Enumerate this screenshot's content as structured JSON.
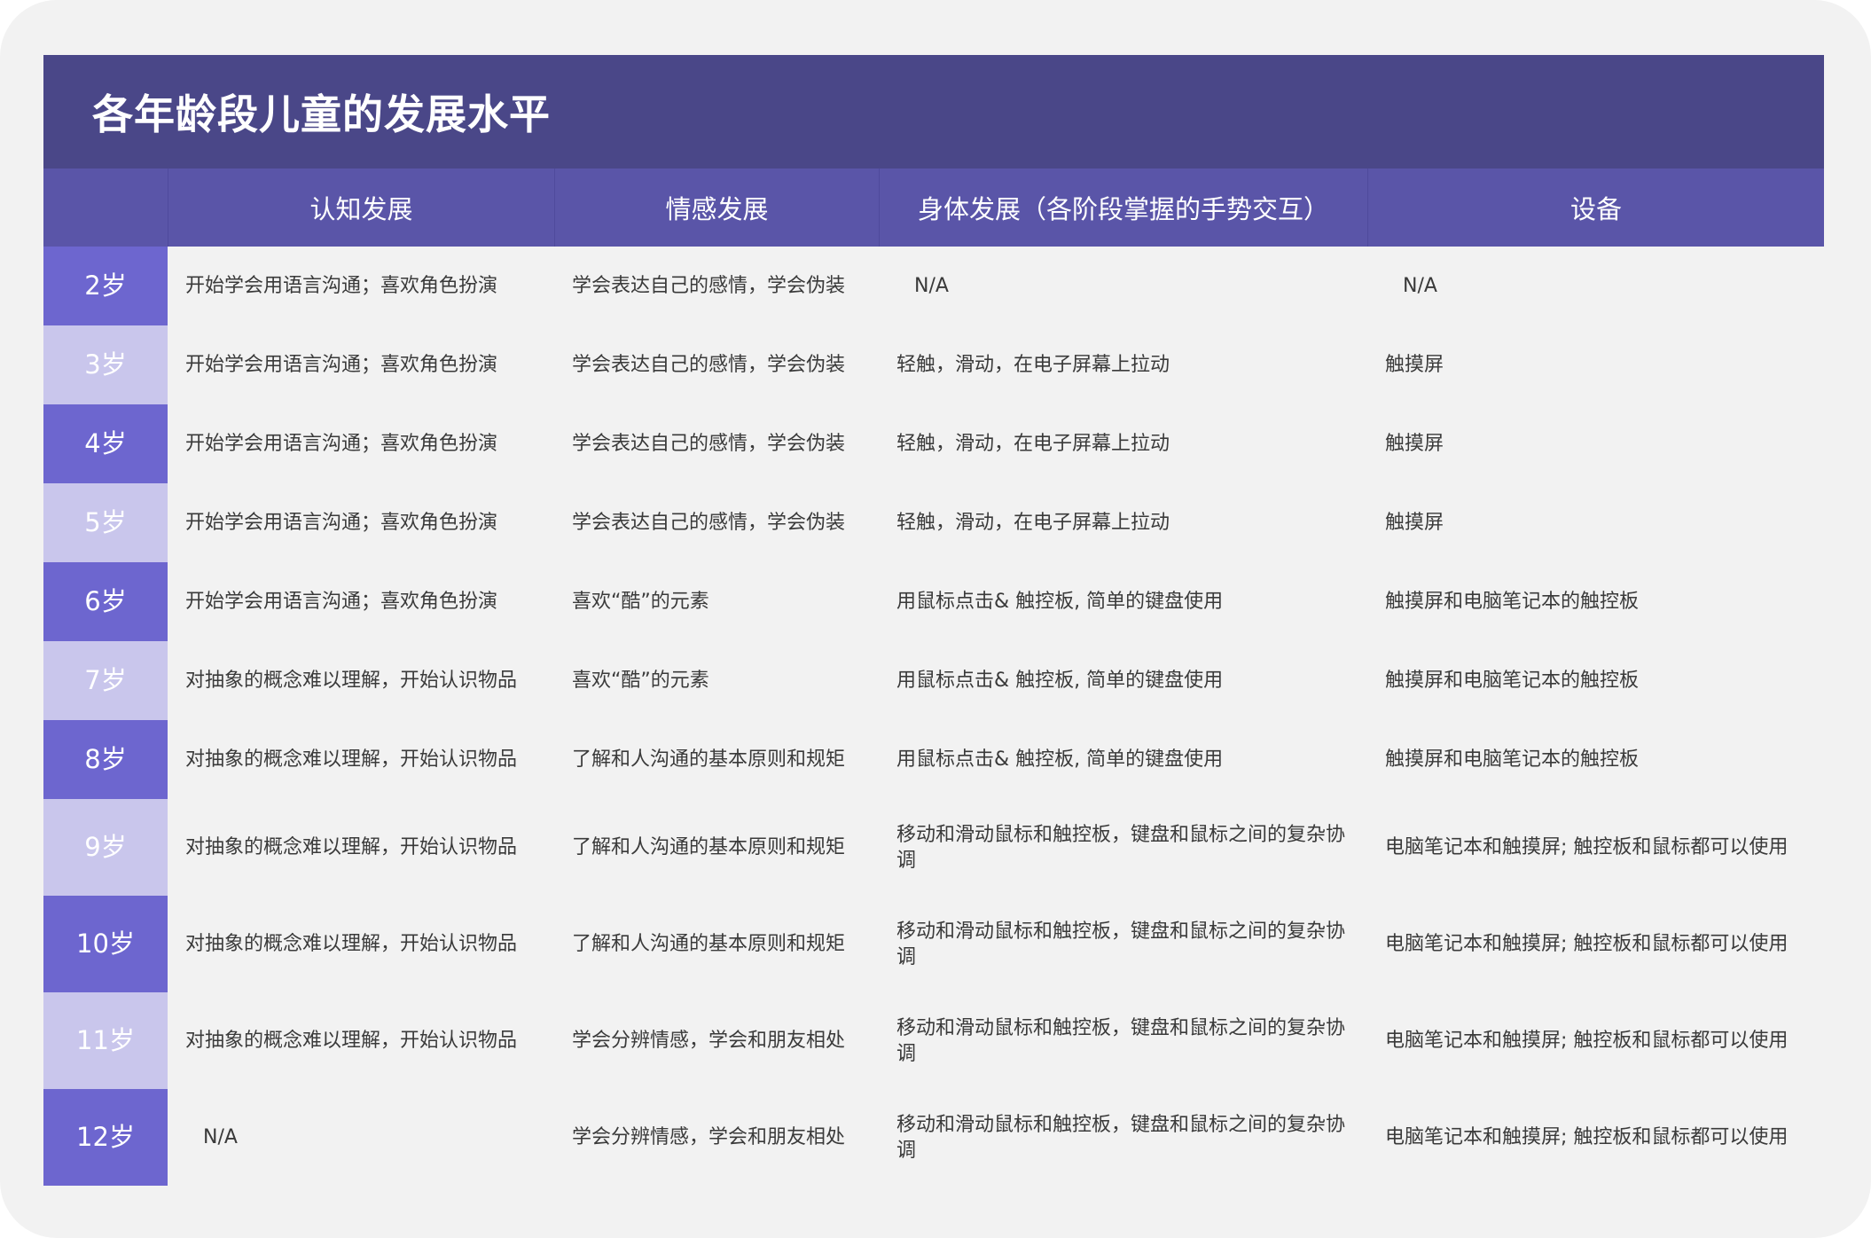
{
  "title": "各年龄段儿童的发展水平",
  "headers": {
    "age": "",
    "cognitive": "认知发展",
    "emotional": "情感发展",
    "physical": "身体发展（各阶段掌握的手势交互）",
    "device": "设备"
  },
  "rows": [
    {
      "age": "2岁",
      "cognitive": "开始学会用语言沟通；喜欢角色扮演",
      "emotional": "学会表达自己的感情，学会伪装",
      "physical": "N/A",
      "device": "N/A"
    },
    {
      "age": "3岁",
      "cognitive": "开始学会用语言沟通；喜欢角色扮演",
      "emotional": "学会表达自己的感情，学会伪装",
      "physical": "轻触，滑动，在电子屏幕上拉动",
      "device": "触摸屏"
    },
    {
      "age": "4岁",
      "cognitive": "开始学会用语言沟通；喜欢角色扮演",
      "emotional": "学会表达自己的感情，学会伪装",
      "physical": "轻触，滑动，在电子屏幕上拉动",
      "device": "触摸屏"
    },
    {
      "age": "5岁",
      "cognitive": "开始学会用语言沟通；喜欢角色扮演",
      "emotional": "学会表达自己的感情，学会伪装",
      "physical": "轻触，滑动，在电子屏幕上拉动",
      "device": "触摸屏"
    },
    {
      "age": "6岁",
      "cognitive": "开始学会用语言沟通；喜欢角色扮演",
      "emotional": "喜欢“酷”的元素",
      "physical": "用鼠标点击& 触控板, 简单的键盘使用",
      "device": "触摸屏和电脑笔记本的触控板"
    },
    {
      "age": "7岁",
      "cognitive": "对抽象的概念难以理解，开始认识物品",
      "emotional": "喜欢“酷”的元素",
      "physical": "用鼠标点击& 触控板, 简单的键盘使用",
      "device": "触摸屏和电脑笔记本的触控板"
    },
    {
      "age": "8岁",
      "cognitive": "对抽象的概念难以理解，开始认识物品",
      "emotional": "了解和人沟通的基本原则和规矩",
      "physical": "用鼠标点击& 触控板, 简单的键盘使用",
      "device": "触摸屏和电脑笔记本的触控板"
    },
    {
      "age": "9岁",
      "cognitive": "对抽象的概念难以理解，开始认识物品",
      "emotional": "了解和人沟通的基本原则和规矩",
      "physical": "移动和滑动鼠标和触控板，键盘和鼠标之间的复杂协调",
      "device": "电脑笔记本和触摸屏; 触控板和鼠标都可以使用"
    },
    {
      "age": "10岁",
      "cognitive": "对抽象的概念难以理解，开始认识物品",
      "emotional": "了解和人沟通的基本原则和规矩",
      "physical": "移动和滑动鼠标和触控板，键盘和鼠标之间的复杂协调",
      "device": "电脑笔记本和触摸屏; 触控板和鼠标都可以使用"
    },
    {
      "age": "11岁",
      "cognitive": "对抽象的概念难以理解，开始认识物品",
      "emotional": "学会分辨情感，学会和朋友相处",
      "physical": "移动和滑动鼠标和触控板，键盘和鼠标之间的复杂协调",
      "device": "电脑笔记本和触摸屏; 触控板和鼠标都可以使用"
    },
    {
      "age": "12岁",
      "cognitive": "N/A",
      "emotional": "学会分辨情感，学会和朋友相处",
      "physical": "移动和滑动鼠标和触控板，键盘和鼠标之间的复杂协调",
      "device": "电脑笔记本和触摸屏; 触控板和鼠标都可以使用"
    }
  ],
  "colors": {
    "title_bar": "#4a4788",
    "header_row": "#5a55a8",
    "age_dark": "#6d66cf",
    "age_light": "#c9c6ec",
    "background": "#f2f2f2"
  }
}
